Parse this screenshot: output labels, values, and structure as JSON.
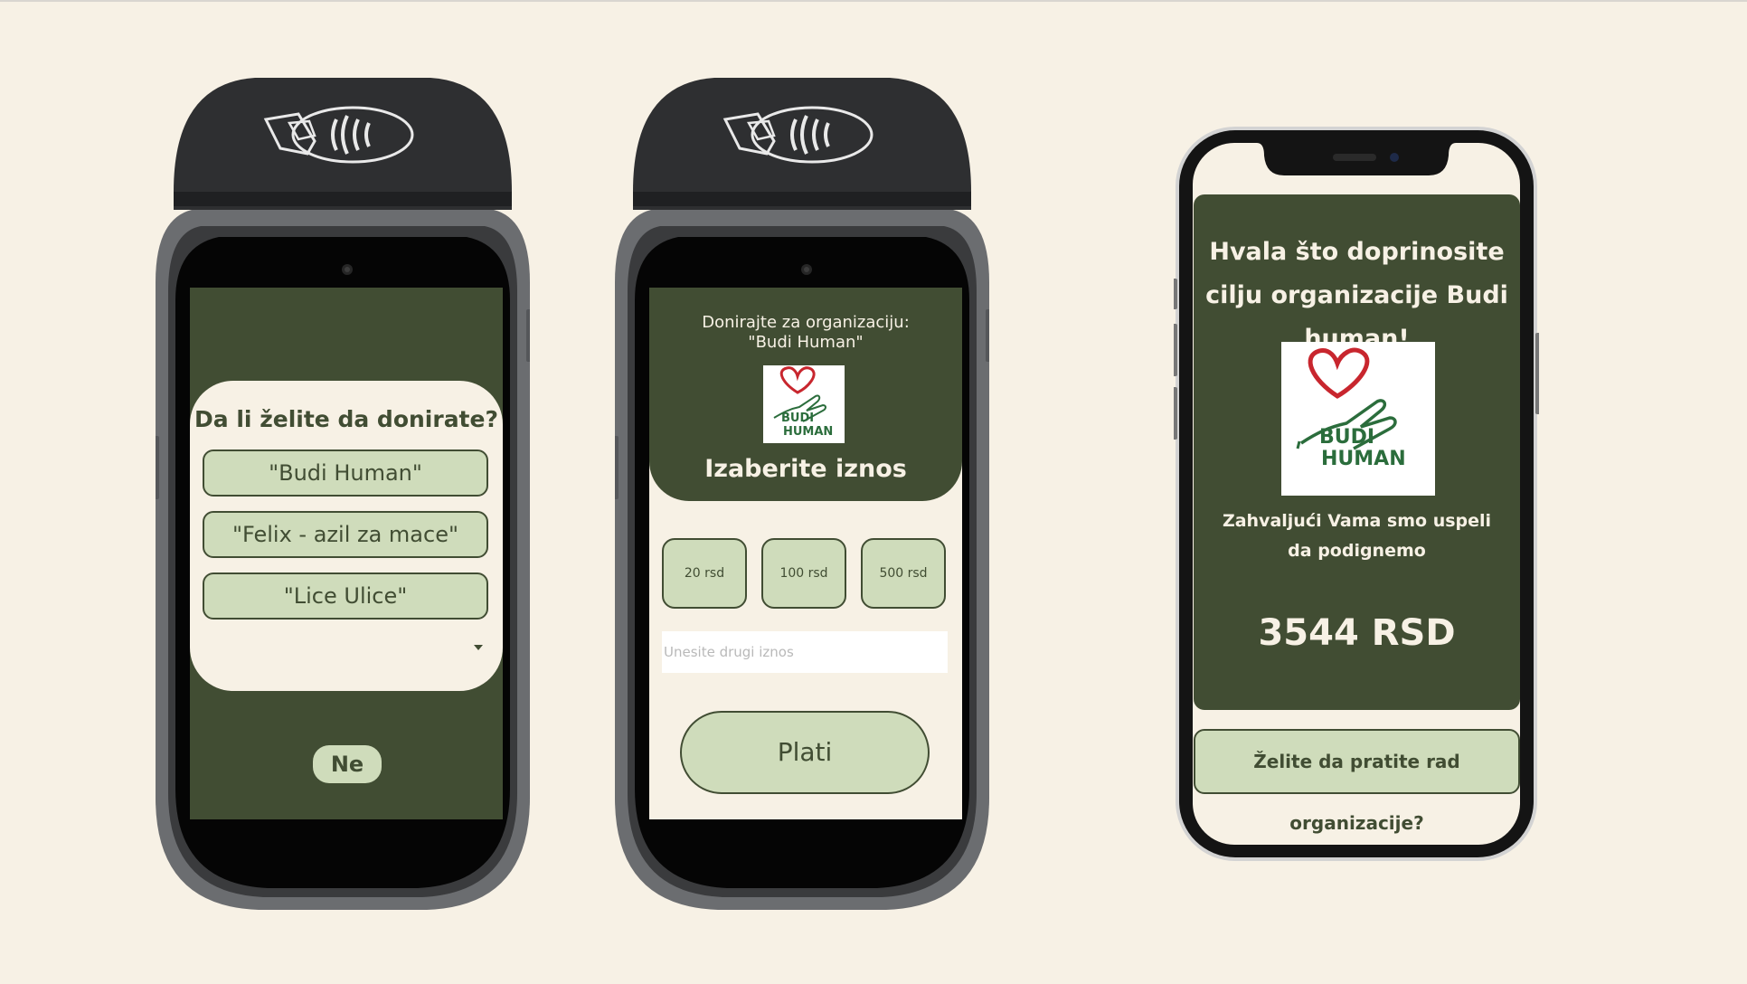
{
  "colors": {
    "background": "#f7f1e5",
    "dark_green": "#414d33",
    "light_green": "#cfdcbb",
    "device_dark": "#2e2f31"
  },
  "terminal1": {
    "question": "Da li želite da donirate?",
    "options": [
      "\"Budi Human\"",
      "\"Felix - azil za mace\"",
      "\"Lice Ulice\""
    ],
    "no_button": "Ne"
  },
  "terminal2": {
    "header_line1": "Donirajte za organizaciju:",
    "header_line2": "\"Budi Human\"",
    "logo_text_1": "BUDI",
    "logo_text_2": "HUMAN",
    "choose_amount": "Izaberite iznos",
    "amounts": [
      "20 rsd",
      "100 rsd",
      "500 rsd"
    ],
    "other_amount_placeholder": "Unesite drugi iznos",
    "pay_button": "Plati"
  },
  "phone": {
    "title": "Hvala što doprinosite cilju organizacije Budi human!",
    "logo_text_1": "BUDI",
    "logo_text_2": "HUMAN",
    "subtitle": "Zahvaljući Vama smo uspeli da podignemo",
    "total": "3544 RSD",
    "follow_button": "Želite da pratite rad organizacije?"
  }
}
